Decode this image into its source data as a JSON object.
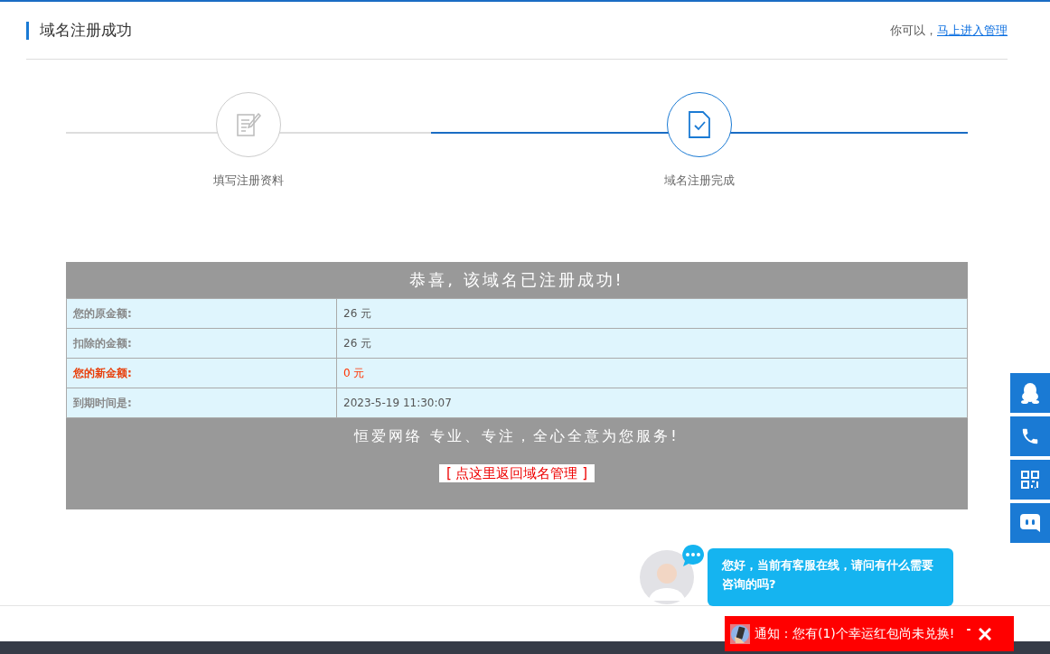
{
  "header": {
    "title": "域名注册成功",
    "hint": "你可以，",
    "link": "马上进入管理"
  },
  "steps": [
    {
      "label": "填写注册资料",
      "kind": "edit",
      "active": false
    },
    {
      "label": "域名注册完成",
      "kind": "done",
      "active": true
    }
  ],
  "result": {
    "title": "恭喜, 该域名已注册成功!",
    "rows": [
      {
        "label": "您的原金额:",
        "value": "26 元",
        "highlight": false
      },
      {
        "label": "扣除的金额:",
        "value": "26 元",
        "highlight": false
      },
      {
        "label": "您的新金额:",
        "value": "0 元",
        "highlight": true
      },
      {
        "label": "到期时间是:",
        "value": "2023-5-19 11:30:07",
        "highlight": false
      }
    ],
    "slogan": "恒爱网络  专业、专注，全心全意为您服务!",
    "back_link": "[ 点这里返回域名管理 ]"
  },
  "side_buttons": [
    {
      "kind": "qq"
    },
    {
      "kind": "phone"
    },
    {
      "kind": "qr"
    },
    {
      "kind": "chat"
    }
  ],
  "chat_popup": {
    "message": "您好，当前有客服在线，请问有什么需要咨询的吗?"
  },
  "notification": {
    "text": "通知：您有(1)个幸运红包尚未兑换!",
    "minimize": "-"
  }
}
